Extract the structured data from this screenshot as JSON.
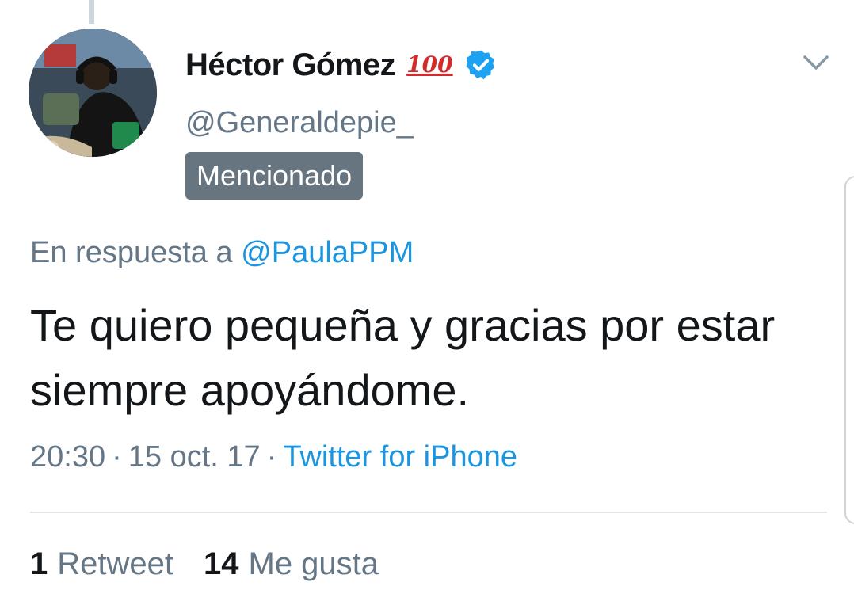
{
  "tweet": {
    "author": {
      "display_name": "Héctor Gómez",
      "emoji": "💯",
      "emoji_text": "100",
      "handle": "@Generaldepie_",
      "verified": true
    },
    "badge": "Mencionado",
    "reply": {
      "prefix": "En respuesta a",
      "to": "@PaulaPPM"
    },
    "text": "Te quiero pequeña y gracias por estar siempre apoyándome.",
    "meta": {
      "time": "20:30",
      "date": "15 oct. 17",
      "separator": "·",
      "source": "Twitter for iPhone"
    },
    "stats": {
      "retweets_count": "1",
      "retweets_label": "Retweet",
      "likes_count": "14",
      "likes_label": "Me gusta"
    }
  },
  "icons": {
    "verified": "verified-badge-icon",
    "chevron": "chevron-down-icon",
    "hundred": "hundred-points-emoji"
  },
  "colors": {
    "link": "#1b95e0",
    "muted": "#657786",
    "text": "#14171a",
    "badge_bg": "#66757f",
    "verified": "#1da1f2",
    "divider": "#e1e8ed"
  }
}
